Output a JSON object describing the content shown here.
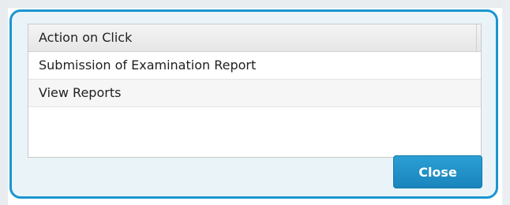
{
  "dialog": {
    "list": {
      "header": "Action on Click",
      "rows": [
        "Submission of Examination Report",
        "View Reports"
      ]
    },
    "close_label": "Close"
  },
  "colors": {
    "dialog_border": "#1b95cf",
    "dialog_background": "#eaf4f8",
    "button_background": "#1a85bd",
    "button_text": "#ffffff"
  }
}
